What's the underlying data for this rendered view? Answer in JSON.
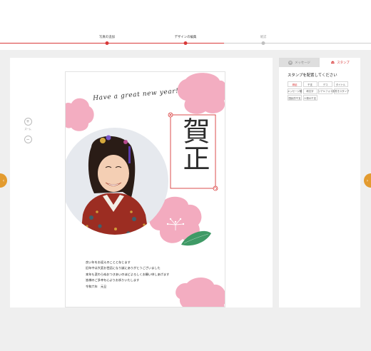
{
  "steps": [
    {
      "label": "写真の追加",
      "state": "done"
    },
    {
      "label": "デザインの編集",
      "state": "current"
    },
    {
      "label": "確認",
      "state": "todo"
    }
  ],
  "zoom": {
    "label": "ズーム",
    "in_icon": "zoom-in-icon",
    "out_icon": "zoom-out-icon"
  },
  "card": {
    "script_heading": "Have a great new year!",
    "kanji_stamp": "賀正",
    "message_lines": [
      "良い年をお迎えのことと存じます",
      "旧年中は大変お世話になり誠にありがとうございました",
      "本年も変わらぬおつきあいのほどよろしくお願い申しあげます",
      "皆様のご多幸を心よりお祈りいたします",
      "令和六年　元旦"
    ],
    "colors": {
      "flower": "#f0a0b8",
      "leaf": "#3f9a66",
      "selection": "#d83a3a"
    }
  },
  "panel": {
    "tabs": [
      {
        "label": "メッセージ",
        "icon": "message-icon",
        "active": false
      },
      {
        "label": "スタンプ",
        "icon": "stamp-icon",
        "active": true
      }
    ],
    "title": "スタンプを配置してください",
    "categories": [
      "縁起",
      "干支",
      "デコ",
      "タイトル",
      "メッセージ類",
      "和文字",
      "リアルフォト",
      "手書きスタンプ",
      "国民的干支",
      "人物の干支"
    ],
    "active_category": "縁起"
  },
  "nav": {
    "left_icon": "chevron-left-icon",
    "right_icon": "chevron-right-icon"
  },
  "accent": "#d83a3a"
}
